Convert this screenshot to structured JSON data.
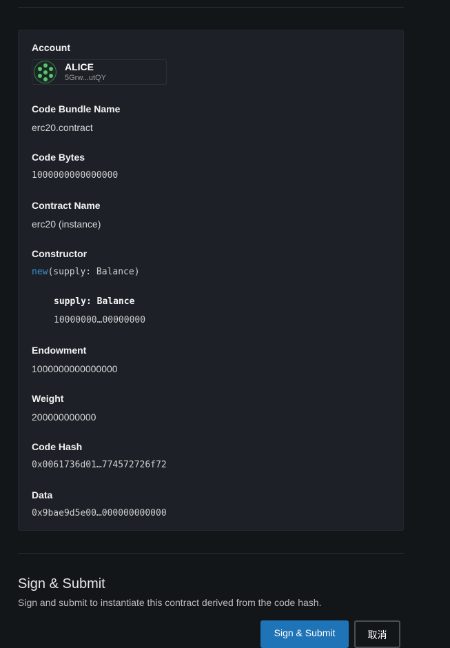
{
  "account": {
    "label": "Account",
    "name": "ALICE",
    "address": "5Grw...utQY",
    "avatar_icon": "identicon-icon"
  },
  "code_bundle": {
    "label": "Code Bundle Name",
    "value": "erc20.contract"
  },
  "code_bytes": {
    "label": "Code Bytes",
    "value": "1000000000000000"
  },
  "contract_name": {
    "label": "Contract Name",
    "value": "erc20 (instance)"
  },
  "constructor": {
    "label": "Constructor",
    "keyword": "new",
    "signature": "(supply: Balance)",
    "param_label": "supply: Balance",
    "param_value": "10000000…00000000"
  },
  "endowment": {
    "label": "Endowment",
    "value": "1000000000000000"
  },
  "weight": {
    "label": "Weight",
    "value": "200000000000"
  },
  "code_hash": {
    "label": "Code Hash",
    "value": "0x0061736d01…774572726f72"
  },
  "data_field": {
    "label": "Data",
    "value": "0x9bae9d5e00…000000000000"
  },
  "sign_section": {
    "title": "Sign & Submit",
    "description": "Sign and submit to instantiate this contract derived from the code hash.",
    "submit_label": "Sign & Submit",
    "cancel_label": "取消"
  },
  "colors": {
    "primary_button": "#1f73b7",
    "keyword": "#3d8fd1",
    "background": "#131619",
    "card": "#1d2127"
  }
}
